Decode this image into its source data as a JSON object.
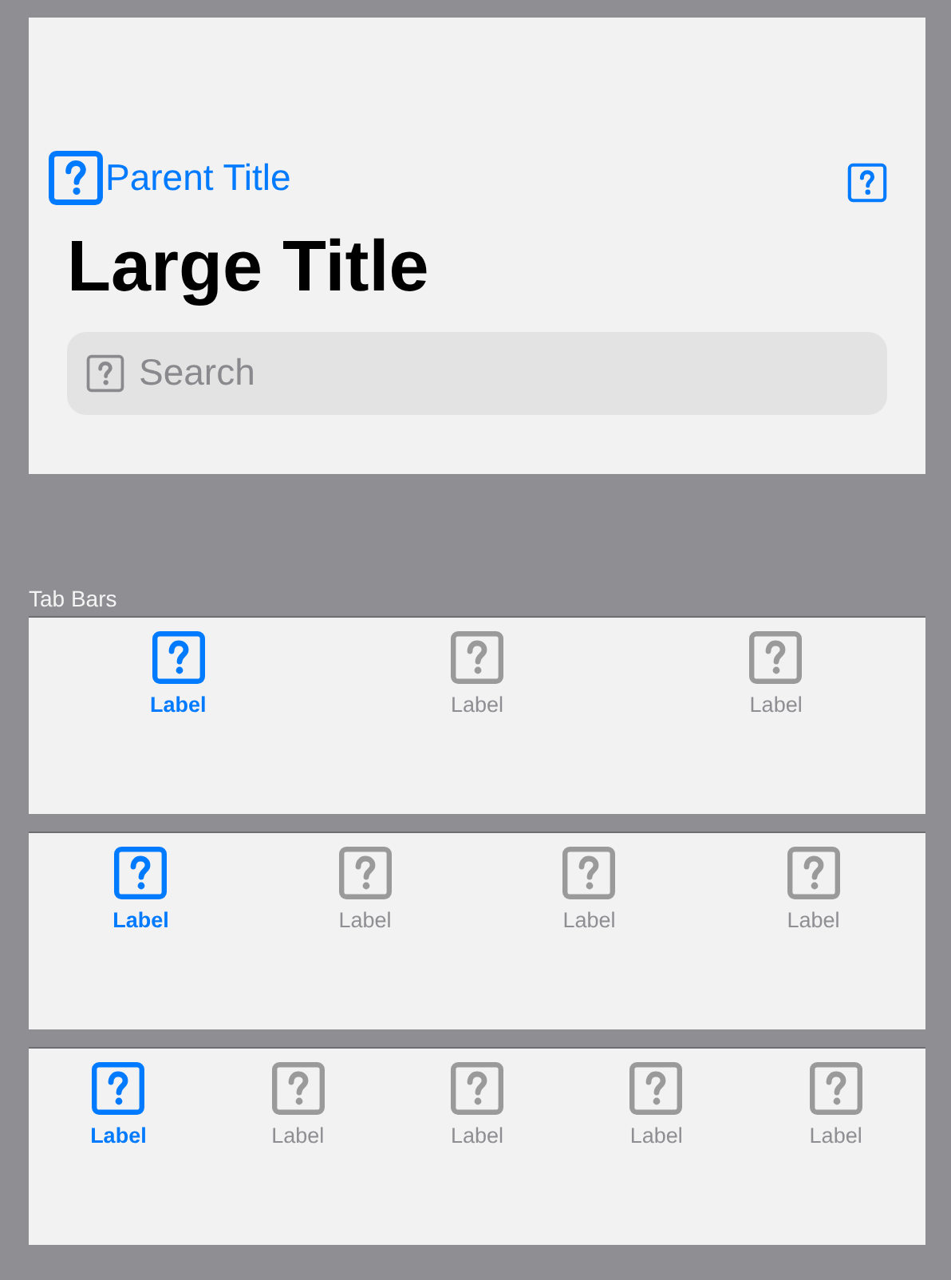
{
  "navigation_bar": {
    "back_title": "Parent Title",
    "title": "Large Title",
    "search": {
      "placeholder": "Search"
    }
  },
  "section_label": "Tab Bars",
  "tab_bars": [
    {
      "items": [
        {
          "label": "Label",
          "selected": true
        },
        {
          "label": "Label",
          "selected": false
        },
        {
          "label": "Label",
          "selected": false
        }
      ]
    },
    {
      "items": [
        {
          "label": "Label",
          "selected": true
        },
        {
          "label": "Label",
          "selected": false
        },
        {
          "label": "Label",
          "selected": false
        },
        {
          "label": "Label",
          "selected": false
        }
      ]
    },
    {
      "items": [
        {
          "label": "Label",
          "selected": true
        },
        {
          "label": "Label",
          "selected": false
        },
        {
          "label": "Label",
          "selected": false
        },
        {
          "label": "Label",
          "selected": false
        },
        {
          "label": "Label",
          "selected": false
        }
      ]
    }
  ]
}
